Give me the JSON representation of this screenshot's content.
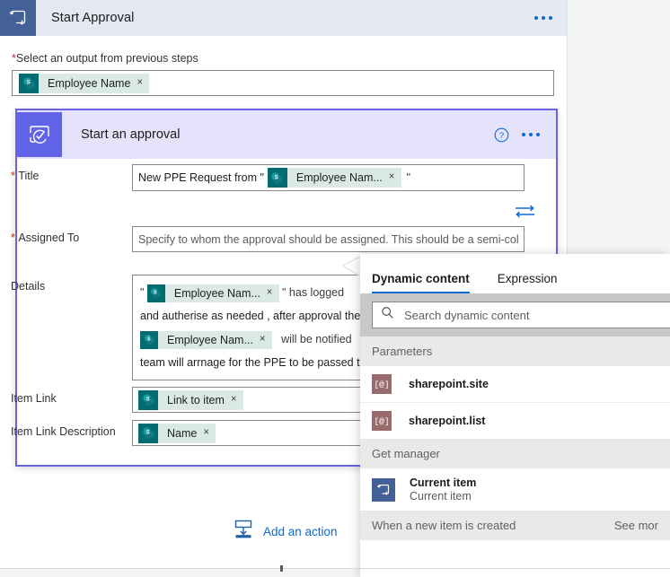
{
  "trigger": {
    "title": "Start Approval",
    "icon": "flow-trigger-icon",
    "more_label": "···"
  },
  "prev_step": {
    "label": "Select an output from previous steps",
    "required": true,
    "token": {
      "label": "Employee Name",
      "icon": "sharepoint-icon",
      "remove": "×"
    }
  },
  "action": {
    "title": "Start an approval",
    "icon": "approval-icon",
    "help": "?",
    "more_label": "···",
    "swap_icon": "swap-arrows-icon"
  },
  "fields": {
    "title": {
      "label": "Title",
      "required": true,
      "prefix": "New PPE Request from \"",
      "token": {
        "label": "Employee Nam...",
        "icon": "sharepoint-icon",
        "remove": "×"
      },
      "suffix": "\""
    },
    "assigned_to": {
      "label": "Assigned To",
      "required": true,
      "placeholder": "Specify to whom the approval should be assigned. This should be a semi-colon"
    },
    "details": {
      "label": "Details",
      "required": false,
      "lines": [
        {
          "type": "token-line",
          "pre": "\"",
          "token": "Employee Nam...",
          "post": "\" has logged"
        },
        {
          "type": "text",
          "text": "and autherise as needed , after approval the"
        },
        {
          "type": "token-line",
          "pre": "",
          "token": "Employee Nam...",
          "post": "will be notified"
        },
        {
          "type": "text",
          "text": "team will arrnage for the PPE to be passed t"
        }
      ],
      "token_icon": "sharepoint-icon",
      "token_remove": "×"
    },
    "item_link": {
      "label": "Item Link",
      "token": {
        "label": "Link to item",
        "icon": "sharepoint-icon",
        "remove": "×"
      }
    },
    "item_link_description": {
      "label": "Item Link Description",
      "token": {
        "label": "Name",
        "icon": "sharepoint-icon",
        "remove": "×"
      }
    }
  },
  "add_action": {
    "label": "Add an action",
    "icon": "insert-below-icon"
  },
  "dynamic_content": {
    "tabs": [
      {
        "label": "Dynamic content",
        "active": true
      },
      {
        "label": "Expression",
        "active": false
      }
    ],
    "search": {
      "placeholder": "Search dynamic content",
      "icon": "search-icon"
    },
    "groups": [
      {
        "name": "Parameters",
        "see_more": "",
        "items": [
          {
            "name": "sharepoint.site",
            "sub": "",
            "icon": "parameter-icon",
            "glyph": "[@]"
          },
          {
            "name": "sharepoint.list",
            "sub": "",
            "icon": "parameter-icon",
            "glyph": "[@]"
          }
        ]
      },
      {
        "name": "Get manager",
        "see_more": "",
        "items": [
          {
            "name": "Current item",
            "sub": "Current item",
            "icon": "flow-trigger-icon",
            "glyph": ""
          }
        ]
      },
      {
        "name": "When a new item is created",
        "see_more": "See mor",
        "items": []
      }
    ]
  },
  "colors": {
    "trigger_header_bg": "#e3e8f2",
    "trigger_icon_bg": "#436197",
    "action_header_bg": "#e4e3fb",
    "action_icon_bg": "#6264e7",
    "action_border": "#6a62e0",
    "sharepoint_teal": "#036c70",
    "chip_bg": "#dbe9e6",
    "accent_blue": "#0b6ad2",
    "required_red": "#c42b1c",
    "param_icon_bg": "#9a6b6d"
  }
}
